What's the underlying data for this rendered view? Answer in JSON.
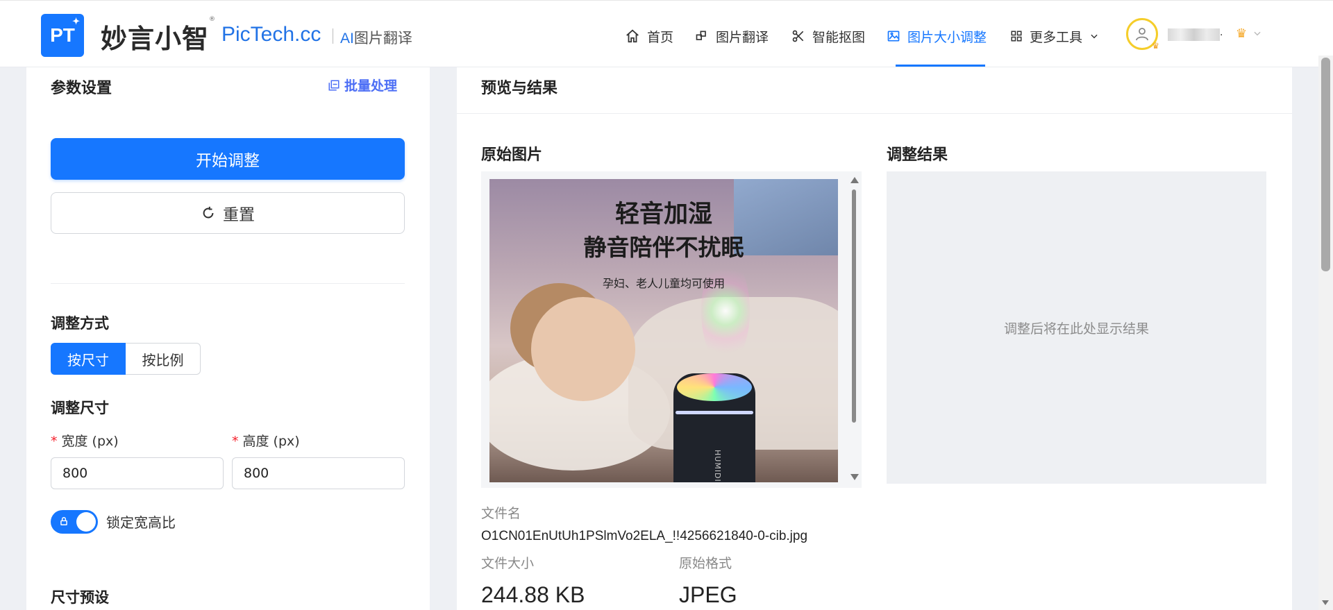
{
  "header": {
    "logo_text": "PT",
    "brand_cn": "妙言小智",
    "brand_en": "PicTech.cc",
    "brand_ai_prefix": "AI",
    "brand_ai_suffix": "图片翻译",
    "nav": [
      {
        "label": "首页",
        "icon": "home-icon"
      },
      {
        "label": "图片翻译",
        "icon": "translate-icon"
      },
      {
        "label": "智能抠图",
        "icon": "scissors-icon"
      },
      {
        "label": "图片大小调整",
        "icon": "image-icon",
        "active": true
      },
      {
        "label": "更多工具",
        "icon": "grid-icon"
      }
    ],
    "user_suffix": "."
  },
  "left": {
    "title": "参数设置",
    "batch_label": "批量处理",
    "start_label": "开始调整",
    "reset_label": "重置",
    "mode_label": "调整方式",
    "mode_options": [
      "按尺寸",
      "按比例"
    ],
    "mode_selected": "按尺寸",
    "size_label": "调整尺寸",
    "width_label": "宽度 (px)",
    "height_label": "高度 (px)",
    "width_value": "800",
    "height_value": "800",
    "lock_label": "锁定宽高比",
    "lock_on": true,
    "preset_label": "尺寸预设"
  },
  "right": {
    "title": "预览与结果",
    "original_title": "原始图片",
    "result_title": "调整结果",
    "result_placeholder": "调整后将在此处显示结果",
    "image_text": {
      "line1": "轻音加湿",
      "line2": "静音陪伴不扰眠",
      "line3": "孕妇、老人儿童均可使用",
      "device_label": "HUMIDIFIER"
    },
    "filename_label": "文件名",
    "filename": "O1CN01EnUtUh1PSlmVo2ELA_!!4256621840-0-cib.jpg",
    "filesize_label": "文件大小",
    "filesize": "244.88 KB",
    "format_label": "原始格式",
    "format": "JPEG"
  },
  "colors": {
    "accent": "#1677ff",
    "brand_blue": "#2273e6",
    "batch": "#4c6ef5",
    "crown": "#f5a623"
  }
}
